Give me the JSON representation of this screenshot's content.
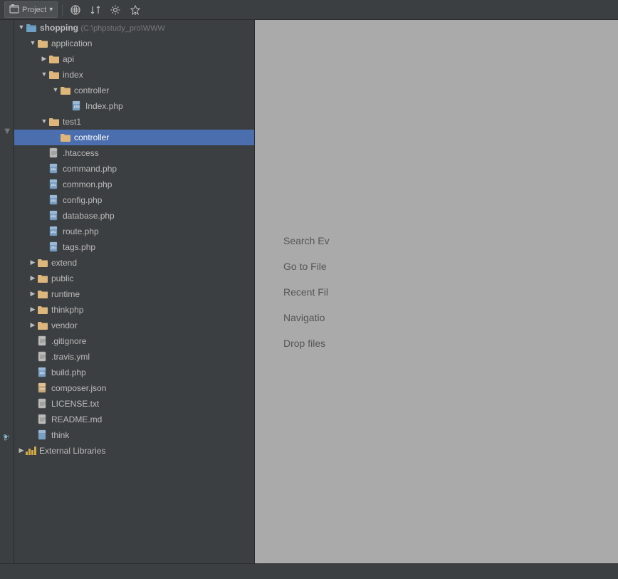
{
  "toolbar": {
    "label": "Project",
    "dropdown_icon": "▾",
    "btn_globe": "⊕",
    "btn_sort": "⇅",
    "btn_gear": "⚙",
    "btn_pin": "📌"
  },
  "tree": {
    "root": {
      "name": "shopping",
      "path": "(C:\\phpstudy_pro\\WWW",
      "type": "project",
      "expanded": true
    },
    "items": [
      {
        "id": "application",
        "label": "application",
        "type": "folder",
        "indent": 1,
        "expanded": true,
        "arrow": "open"
      },
      {
        "id": "api",
        "label": "api",
        "type": "folder",
        "indent": 2,
        "expanded": false,
        "arrow": "closed"
      },
      {
        "id": "index",
        "label": "index",
        "type": "folder",
        "indent": 2,
        "expanded": true,
        "arrow": "open"
      },
      {
        "id": "controller-index",
        "label": "controller",
        "type": "folder",
        "indent": 3,
        "expanded": true,
        "arrow": "open"
      },
      {
        "id": "Index.php",
        "label": "Index.php",
        "type": "php",
        "indent": 4,
        "arrow": "leaf"
      },
      {
        "id": "test1",
        "label": "test1",
        "type": "folder",
        "indent": 2,
        "expanded": true,
        "arrow": "open"
      },
      {
        "id": "controller-test1",
        "label": "controller",
        "type": "folder",
        "indent": 3,
        "expanded": false,
        "arrow": "leaf",
        "selected": true
      },
      {
        "id": ".htaccess",
        "label": ".htaccess",
        "type": "txt",
        "indent": 2,
        "arrow": "leaf"
      },
      {
        "id": "command.php",
        "label": "command.php",
        "type": "php",
        "indent": 2,
        "arrow": "leaf"
      },
      {
        "id": "common.php",
        "label": "common.php",
        "type": "php",
        "indent": 2,
        "arrow": "leaf"
      },
      {
        "id": "config.php",
        "label": "config.php",
        "type": "php",
        "indent": 2,
        "arrow": "leaf"
      },
      {
        "id": "database.php",
        "label": "database.php",
        "type": "php",
        "indent": 2,
        "arrow": "leaf"
      },
      {
        "id": "route.php",
        "label": "route.php",
        "type": "php",
        "indent": 2,
        "arrow": "leaf"
      },
      {
        "id": "tags.php",
        "label": "tags.php",
        "type": "php",
        "indent": 2,
        "arrow": "leaf"
      },
      {
        "id": "extend",
        "label": "extend",
        "type": "folder",
        "indent": 1,
        "expanded": false,
        "arrow": "closed"
      },
      {
        "id": "public",
        "label": "public",
        "type": "folder",
        "indent": 1,
        "expanded": false,
        "arrow": "closed"
      },
      {
        "id": "runtime",
        "label": "runtime",
        "type": "folder",
        "indent": 1,
        "expanded": false,
        "arrow": "closed"
      },
      {
        "id": "thinkphp",
        "label": "thinkphp",
        "type": "folder",
        "indent": 1,
        "expanded": false,
        "arrow": "closed"
      },
      {
        "id": "vendor",
        "label": "vendor",
        "type": "folder",
        "indent": 1,
        "expanded": false,
        "arrow": "closed"
      },
      {
        "id": ".gitignore",
        "label": ".gitignore",
        "type": "txt",
        "indent": 1,
        "arrow": "leaf"
      },
      {
        "id": ".travis.yml",
        "label": ".travis.yml",
        "type": "yml",
        "indent": 1,
        "arrow": "leaf"
      },
      {
        "id": "build.php",
        "label": "build.php",
        "type": "php",
        "indent": 1,
        "arrow": "leaf"
      },
      {
        "id": "composer.json",
        "label": "composer.json",
        "type": "json",
        "indent": 1,
        "arrow": "leaf"
      },
      {
        "id": "LICENSE.txt",
        "label": "LICENSE.txt",
        "type": "txt",
        "indent": 1,
        "arrow": "leaf"
      },
      {
        "id": "README.md",
        "label": "README.md",
        "type": "md",
        "indent": 1,
        "arrow": "leaf"
      },
      {
        "id": "think",
        "label": "think",
        "type": "think",
        "indent": 1,
        "arrow": "leaf"
      },
      {
        "id": "external-libraries",
        "label": "External Libraries",
        "type": "lib",
        "indent": 0,
        "arrow": "closed"
      }
    ]
  },
  "right_panel": {
    "shortcuts": [
      {
        "label": "Search Ev",
        "key": ""
      },
      {
        "label": "Go to File",
        "key": ""
      },
      {
        "label": "Recent Fil",
        "key": ""
      },
      {
        "label": "Navigatio",
        "key": ""
      },
      {
        "label": "Drop files",
        "key": ""
      }
    ]
  }
}
